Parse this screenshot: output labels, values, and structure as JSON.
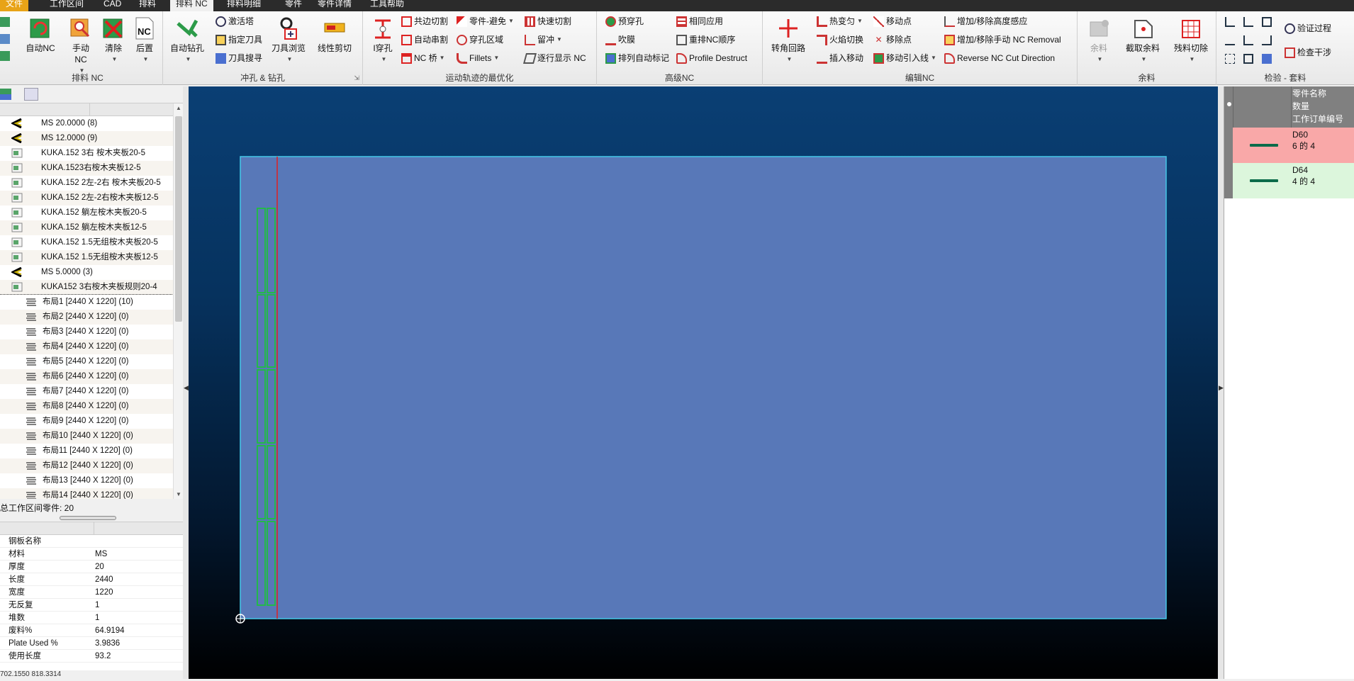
{
  "menu": {
    "items": [
      "文件",
      "工作区间",
      "CAD",
      "排料",
      "排料 NC",
      "排料明细",
      "零件",
      "零件详情",
      "工具帮助"
    ],
    "active_index": 4
  },
  "ribbon": {
    "nc_group": {
      "label": "排料 NC",
      "auto_nc": "自动NC",
      "manual_nc": "手动\nNC",
      "clear": "清除",
      "post": "后置"
    },
    "punch_group": {
      "label": "冲孔 & 钻孔",
      "auto_drill": "自动钻孔",
      "activate_tower": "激活塔",
      "assign_tool": "指定刀具",
      "tool_search": "刀具搜寻",
      "tool_browse": "刀具浏览",
      "linear_cut": "线性剪切"
    },
    "motion_group": {
      "label": "运动轨迹的最优化",
      "pierce": "I穿孔",
      "common_cut": "共边切割",
      "chain_cut": "自动串割",
      "nc_bridge": "NC 桥",
      "part_avoid": "零件-避免",
      "pierce_area": "穿孔区域",
      "fillets": "Fillets",
      "fast_cut": "快速切割",
      "microjoint": "留冲",
      "step_display": "逐行显示 NC"
    },
    "adv_group": {
      "label": "高级NC",
      "pre_pierce": "预穿孔",
      "blow_film": "吹膜",
      "auto_mark": "排列自动标记",
      "same_apply": "相同应用",
      "resort_nc": "重排NC顺序",
      "profile_destruct": "Profile Destruct"
    },
    "edit_group": {
      "label": "编辑NC",
      "corner_loop": "转角回路",
      "heat_trans": "热变匀",
      "flame_switch": "火焰切换",
      "insert_move": "插入移动",
      "move_point": "移动点",
      "remove_point": "移除点",
      "move_lead": "移动引入线",
      "height_sense": "增加/移除高度感应",
      "manual_nc_removal": "增加/移除手动 NC Removal",
      "reverse_cut": "Reverse NC Cut Direction"
    },
    "remnant_group": {
      "label": "余料",
      "remnant": "余料",
      "cut_remnant": "截取余料",
      "scrap_cut": "残料切除"
    },
    "check_group": {
      "label": "检验 - 套料",
      "verify_process": "验证过程",
      "check_interference": "检查干涉"
    }
  },
  "tree": {
    "rows": [
      {
        "text": "MS 20.0000 (8)",
        "kind": "material"
      },
      {
        "text": "MS 12.0000 (9)",
        "kind": "material"
      },
      {
        "text": "KUKA.152 3右 桉木夹板20-5",
        "kind": "part"
      },
      {
        "text": "KUKA.1523右桉木夹板12-5",
        "kind": "part"
      },
      {
        "text": "KUKA.152 2左-2右 桉木夹板20-5",
        "kind": "part"
      },
      {
        "text": "KUKA.152  2左-2右桉木夹板12-5",
        "kind": "part"
      },
      {
        "text": "KUKA.152  躺左桉木夹板20-5",
        "kind": "part"
      },
      {
        "text": "KUKA.152  躺左桉木夹板12-5",
        "kind": "part"
      },
      {
        "text": "KUKA.152  1.5无组桉木夹板20-5",
        "kind": "part"
      },
      {
        "text": "KUKA.152  1.5无组桉木夹板12-5",
        "kind": "part"
      },
      {
        "text": "MS 5.0000 (3)",
        "kind": "material"
      },
      {
        "text": "KUKA152 3右桉木夹板规则20-4",
        "kind": "part"
      },
      {
        "text": "布局1 [2440 X 1220]  (10)",
        "kind": "layout",
        "selected": true
      },
      {
        "text": "布局2 [2440 X 1220]  (0)",
        "kind": "layout"
      },
      {
        "text": "布局3 [2440 X 1220]  (0)",
        "kind": "layout"
      },
      {
        "text": "布局4 [2440 X 1220]  (0)",
        "kind": "layout"
      },
      {
        "text": "布局5 [2440 X 1220]  (0)",
        "kind": "layout"
      },
      {
        "text": "布局6 [2440 X 1220]  (0)",
        "kind": "layout"
      },
      {
        "text": "布局7 [2440 X 1220]  (0)",
        "kind": "layout"
      },
      {
        "text": "布局8 [2440 X 1220]  (0)",
        "kind": "layout"
      },
      {
        "text": "布局9 [2440 X 1220]  (0)",
        "kind": "layout"
      },
      {
        "text": "布局10 [2440 X 1220]  (0)",
        "kind": "layout"
      },
      {
        "text": "布局11 [2440 X 1220]  (0)",
        "kind": "layout"
      },
      {
        "text": "布局12 [2440 X 1220]  (0)",
        "kind": "layout"
      },
      {
        "text": "布局13 [2440 X 1220]  (0)",
        "kind": "layout"
      },
      {
        "text": "布局14 [2440 X 1220]  (0)",
        "kind": "layout"
      }
    ]
  },
  "workspace_count": "总工作区间零件: 20",
  "properties": {
    "title": "钢板名称",
    "rows": [
      {
        "key": "材料",
        "value": "MS"
      },
      {
        "key": "厚度",
        "value": "20"
      },
      {
        "key": "长度",
        "value": "2440"
      },
      {
        "key": "宽度",
        "value": "1220"
      },
      {
        "key": "无反复",
        "value": "1"
      },
      {
        "key": "堆数",
        "value": "1"
      },
      {
        "key": "废料%",
        "value": "64.9194"
      },
      {
        "key": "Plate Used %",
        "value": "3.9836"
      },
      {
        "key": "使用长度",
        "value": "93.2"
      }
    ]
  },
  "status_coords": "702.1550  818.3314",
  "right_panel": {
    "headers": [
      "零件名称",
      "数量",
      "工作订单编号"
    ],
    "parts": [
      {
        "name": "D60",
        "qty": "6 的 4",
        "color": "#f9a8a8"
      },
      {
        "name": "D64",
        "qty": "4 的 4",
        "color": "#dcf6dc"
      }
    ]
  },
  "colors": {
    "plate": "#5878b8",
    "plate_border": "#46c8e8",
    "part_outline": "#1fbf3f",
    "red_line": "#e02020"
  }
}
